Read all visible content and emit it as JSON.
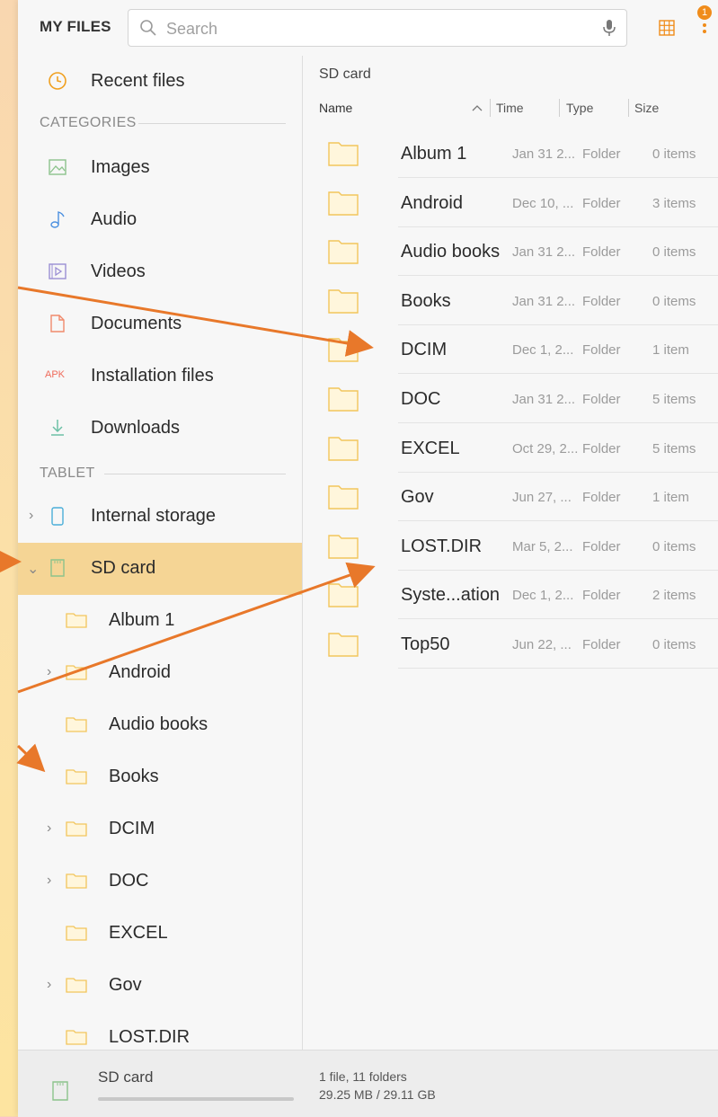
{
  "header": {
    "title": "MY FILES",
    "search_placeholder": "Search",
    "notification_count": "1"
  },
  "sidebar": {
    "recent": "Recent files",
    "categories_heading": "CATEGORIES",
    "categories": [
      {
        "label": "Images",
        "icon": "image-icon"
      },
      {
        "label": "Audio",
        "icon": "music-note-icon"
      },
      {
        "label": "Videos",
        "icon": "video-icon"
      },
      {
        "label": "Documents",
        "icon": "document-icon"
      },
      {
        "label": "Installation files",
        "icon": "apk-icon",
        "icon_text": "APK"
      },
      {
        "label": "Downloads",
        "icon": "download-icon"
      }
    ],
    "tablet_heading": "TABLET",
    "internal_storage": "Internal storage",
    "sd_card": "SD card",
    "sd_folders": [
      "Album 1",
      "Android",
      "Audio books",
      "Books",
      "DCIM",
      "DOC",
      "EXCEL",
      "Gov",
      "LOST.DIR"
    ]
  },
  "main": {
    "breadcrumb": "SD card",
    "columns": {
      "name": "Name",
      "time": "Time",
      "type": "Type",
      "size": "Size"
    },
    "rows": [
      {
        "name": "Album 1",
        "time": "Jan 31 2...",
        "type": "Folder",
        "size": "0 items"
      },
      {
        "name": "Android",
        "time": "Dec 10, ...",
        "type": "Folder",
        "size": "3 items"
      },
      {
        "name": "Audio books",
        "time": "Jan 31 2...",
        "type": "Folder",
        "size": "0 items"
      },
      {
        "name": "Books",
        "time": "Jan 31 2...",
        "type": "Folder",
        "size": "0 items"
      },
      {
        "name": "DCIM",
        "time": "Dec 1, 2...",
        "type": "Folder",
        "size": "1 item"
      },
      {
        "name": "DOC",
        "time": "Jan 31 2...",
        "type": "Folder",
        "size": "5 items"
      },
      {
        "name": "EXCEL",
        "time": "Oct 29, 2...",
        "type": "Folder",
        "size": "5 items"
      },
      {
        "name": "Gov",
        "time": "Jun 27, ...",
        "type": "Folder",
        "size": "1 item"
      },
      {
        "name": "LOST.DIR",
        "time": "Mar 5, 2...",
        "type": "Folder",
        "size": "0 items"
      },
      {
        "name": "Syste...ation",
        "time": "Dec 1, 2...",
        "type": "Folder",
        "size": "2 items"
      },
      {
        "name": "Top50",
        "time": "Jun 22, ...",
        "type": "Folder",
        "size": "0 items"
      }
    ]
  },
  "status": {
    "storage_label": "SD card",
    "summary": "1 file, 11 folders",
    "usage": "29.25 MB / 29.11 GB"
  },
  "colors": {
    "accent": "#f08c1a",
    "selected_bg": "#f5d595",
    "folder_fill": "#fff6dc",
    "folder_stroke": "#f2c55c",
    "annotation_arrow": "#e8782a"
  }
}
